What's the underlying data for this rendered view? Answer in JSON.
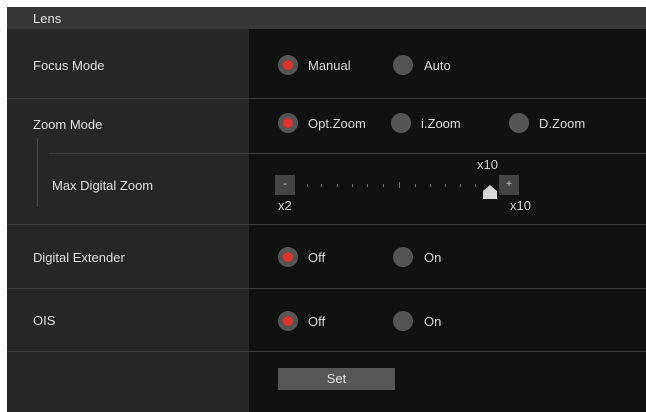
{
  "header": {
    "title": "Lens"
  },
  "focus_mode": {
    "label": "Focus Mode",
    "options": [
      "Manual",
      "Auto"
    ],
    "selected": "Manual"
  },
  "zoom_mode": {
    "label": "Zoom Mode",
    "options": [
      "Opt.Zoom",
      "i.Zoom",
      "D.Zoom"
    ],
    "selected": "Opt.Zoom"
  },
  "max_digital_zoom": {
    "label": "Max Digital Zoom",
    "current": "x10",
    "min_label": "x2",
    "max_label": "x10",
    "minus": "-",
    "plus": "+",
    "fraction": 1.0
  },
  "digital_extender": {
    "label": "Digital Extender",
    "options": [
      "Off",
      "On"
    ],
    "selected": "Off"
  },
  "ois": {
    "label": "OIS",
    "options": [
      "Off",
      "On"
    ],
    "selected": "Off"
  },
  "set_button": {
    "label": "Set"
  },
  "colors": {
    "selected_radio": "#e0332b",
    "background": "#111111",
    "label_column": "#262626"
  }
}
